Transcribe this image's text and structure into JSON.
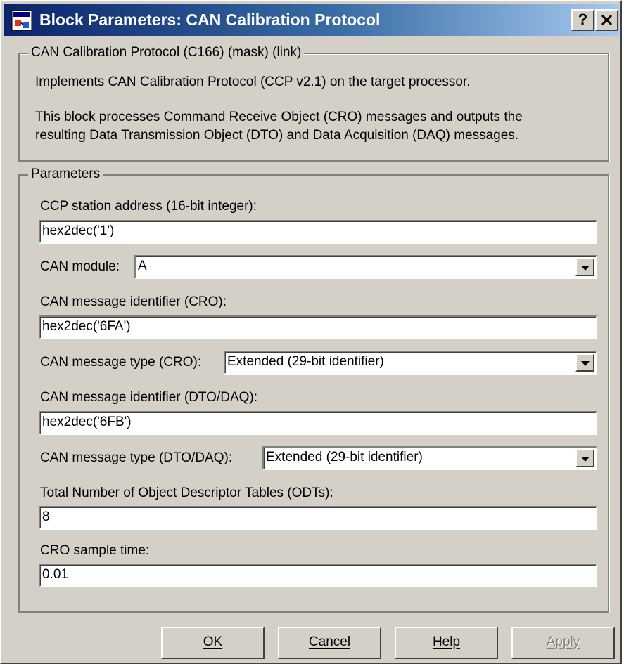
{
  "window": {
    "title": "Block Parameters: CAN Calibration Protocol",
    "help_button": "?",
    "close_button": "✕"
  },
  "description": {
    "group_label": "CAN Calibration Protocol (C166) (mask) (link)",
    "line1": "Implements CAN Calibration Protocol (CCP v2.1) on the target processor.",
    "line2": "This block processes Command Receive Object (CRO) messages and outputs the",
    "line3": "resulting Data Transmission Object (DTO) and Data Acquisition (DAQ) messages."
  },
  "parameters": {
    "group_label": "Parameters",
    "station_address": {
      "label": "CCP station address (16-bit integer):",
      "value": "hex2dec('1')"
    },
    "can_module": {
      "label": "CAN module:",
      "value": "A"
    },
    "cro_identifier": {
      "label": "CAN message identifier (CRO):",
      "value": "hex2dec('6FA')"
    },
    "cro_type": {
      "label": "CAN message type (CRO):",
      "value": "Extended (29-bit identifier)"
    },
    "dto_identifier": {
      "label": "CAN message identifier (DTO/DAQ):",
      "value": "hex2dec('6FB')"
    },
    "dto_type": {
      "label": "CAN message type (DTO/DAQ):",
      "value": "Extended (29-bit identifier)"
    },
    "odt_count": {
      "label": "Total Number of Object Descriptor Tables (ODTs):",
      "value": "8"
    },
    "cro_sample_time": {
      "label": "CRO sample time:",
      "value": "0.01"
    }
  },
  "buttons": {
    "ok": "OK",
    "cancel": "Cancel",
    "help": "Help",
    "apply": "Apply"
  },
  "colors": {
    "title_bar_start": "#0a246a",
    "title_bar_end": "#a6caf0",
    "dialog_face": "#d4d0c8"
  },
  "icons": {
    "app": "simulink-block-icon",
    "help": "question-mark-icon",
    "close": "close-icon",
    "dropdown": "chevron-down-icon"
  }
}
